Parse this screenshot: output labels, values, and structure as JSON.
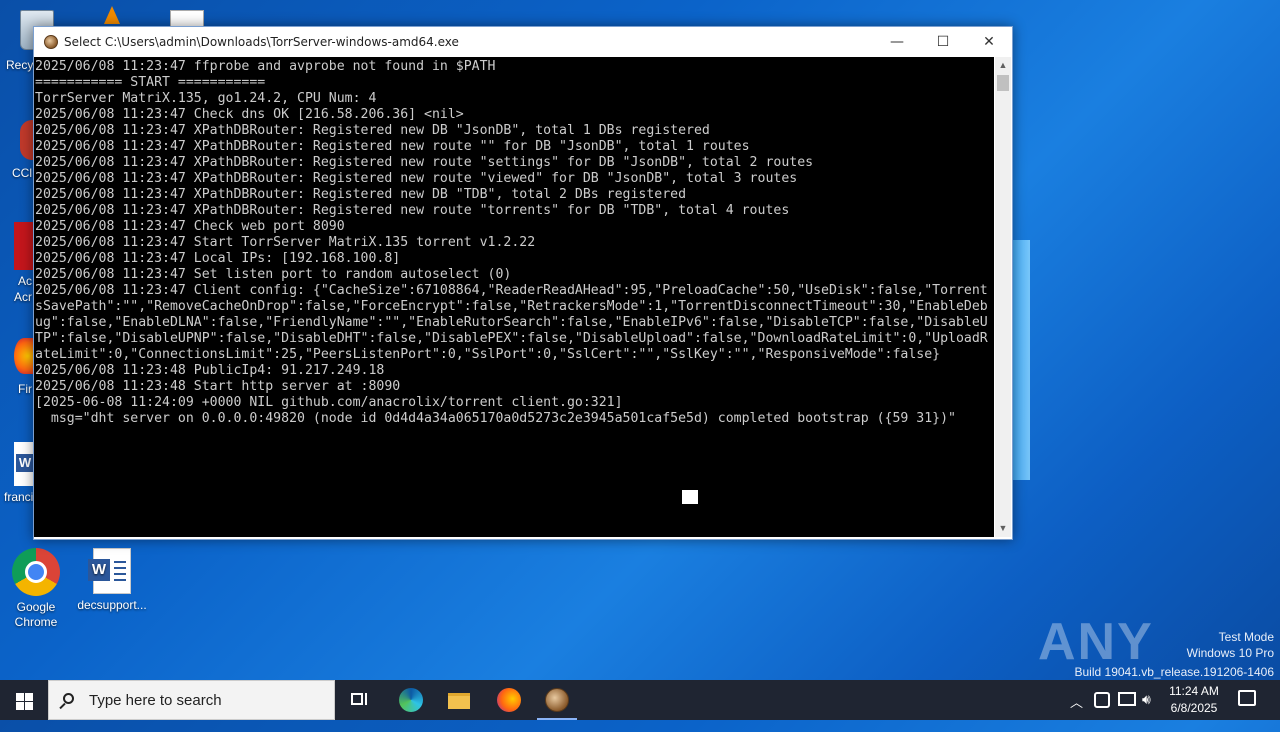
{
  "desktop": {
    "icons": [
      {
        "label": "Google Chrome",
        "id": "chrome"
      },
      {
        "label": "decsupport...",
        "id": "word"
      }
    ],
    "partial_labels": [
      "Recy",
      "CCl",
      "Ac",
      "Acr",
      "Fir",
      "franci"
    ],
    "watermark": {
      "line1": "Test Mode",
      "line2": "Windows 10 Pro",
      "line3": "Build 19041.vb_release.191206-1406",
      "brand": "ANY RUN"
    }
  },
  "window": {
    "title": "Select C:\\Users\\admin\\Downloads\\TorrServer-windows-amd64.exe",
    "controls": {
      "minimize": "—",
      "maximize": "☐",
      "close": "✕"
    },
    "console_lines": [
      "2025/06/08 11:23:47 ffprobe and avprobe not found in $PATH",
      "=========== START ===========",
      "TorrServer MatriX.135, go1.24.2, CPU Num: 4",
      "2025/06/08 11:23:47 Check dns OK [216.58.206.36] <nil>",
      "2025/06/08 11:23:47 XPathDBRouter: Registered new DB \"JsonDB\", total 1 DBs registered",
      "2025/06/08 11:23:47 XPathDBRouter: Registered new route \"\" for DB \"JsonDB\", total 1 routes",
      "2025/06/08 11:23:47 XPathDBRouter: Registered new route \"settings\" for DB \"JsonDB\", total 2 routes",
      "2025/06/08 11:23:47 XPathDBRouter: Registered new route \"viewed\" for DB \"JsonDB\", total 3 routes",
      "2025/06/08 11:23:47 XPathDBRouter: Registered new DB \"TDB\", total 2 DBs registered",
      "2025/06/08 11:23:47 XPathDBRouter: Registered new route \"torrents\" for DB \"TDB\", total 4 routes",
      "2025/06/08 11:23:47 Check web port 8090",
      "2025/06/08 11:23:47 Start TorrServer MatriX.135 torrent v1.2.22",
      "2025/06/08 11:23:47 Local IPs: [192.168.100.8]",
      "2025/06/08 11:23:47 Set listen port to random autoselect (0)",
      "2025/06/08 11:23:47 Client config: {\"CacheSize\":67108864,\"ReaderReadAHead\":95,\"PreloadCache\":50,\"UseDisk\":false,\"Torrent",
      "sSavePath\":\"\",\"RemoveCacheOnDrop\":false,\"ForceEncrypt\":false,\"RetrackersMode\":1,\"TorrentDisconnectTimeout\":30,\"EnableDeb",
      "ug\":false,\"EnableDLNA\":false,\"FriendlyName\":\"\",\"EnableRutorSearch\":false,\"EnableIPv6\":false,\"DisableTCP\":false,\"DisableU",
      "TP\":false,\"DisableUPNP\":false,\"DisableDHT\":false,\"DisablePEX\":false,\"DisableUpload\":false,\"DownloadRateLimit\":0,\"UploadR",
      "ateLimit\":0,\"ConnectionsLimit\":25,\"PeersListenPort\":0,\"SslPort\":0,\"SslCert\":\"\",\"SslKey\":\"\",\"ResponsiveMode\":false}",
      "2025/06/08 11:23:48 PublicIp4: 91.217.249.18",
      "2025/06/08 11:23:48 Start http server at :8090",
      "[2025-06-08 11:24:09 +0000 NIL github.com/anacrolix/torrent client.go:321]",
      "  msg=\"dht server on 0.0.0.0:49820 (node id 0d4d4a34a065170a0d5273c2e3945a501caf5e5d) completed bootstrap ({59 31})\""
    ]
  },
  "taskbar": {
    "search_placeholder": "Type here to search",
    "clock_time": "11:24 AM",
    "clock_date": "6/8/2025"
  }
}
